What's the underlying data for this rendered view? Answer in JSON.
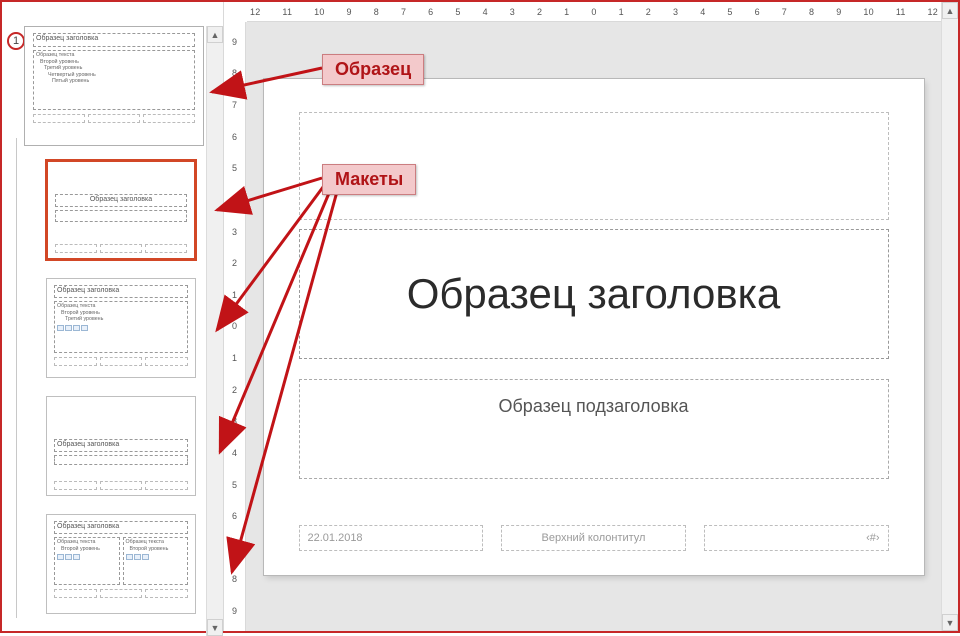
{
  "masterNumber": "1",
  "ruler": {
    "horizontal": [
      "12",
      "11",
      "10",
      "9",
      "8",
      "7",
      "6",
      "5",
      "4",
      "3",
      "2",
      "1",
      "0",
      "1",
      "2",
      "3",
      "4",
      "5",
      "6",
      "7",
      "8",
      "9",
      "10",
      "11",
      "12"
    ],
    "vertical": [
      "9",
      "8",
      "7",
      "6",
      "5",
      "4",
      "3",
      "2",
      "1",
      "0",
      "1",
      "2",
      "3",
      "4",
      "5",
      "6",
      "7",
      "8",
      "9"
    ]
  },
  "masterThumb": {
    "title": "Образец заголовка",
    "bodyLabel": "Образец текста",
    "levels": [
      "Второй уровень",
      "Третий уровень",
      "Четвертый уровень",
      "Пятый уровень"
    ]
  },
  "layouts": [
    {
      "kind": "titleSlide",
      "title": "Образец заголовка"
    },
    {
      "kind": "titleContent",
      "title": "Образец заголовка",
      "bodyLabel": "Образец текста"
    },
    {
      "kind": "sectionHeader",
      "title": "Образец заголовка"
    },
    {
      "kind": "twoContent",
      "title": "Образец заголовка",
      "bodyLabel": "Образец текста"
    }
  ],
  "slide": {
    "title": "Образец заголовка",
    "subtitle": "Образец подзаголовка",
    "date": "22.01.2018",
    "footer": "Верхний колонтитул",
    "pageNum": "‹#›"
  },
  "annotations": {
    "master": "Образец",
    "layouts": "Макеты"
  }
}
